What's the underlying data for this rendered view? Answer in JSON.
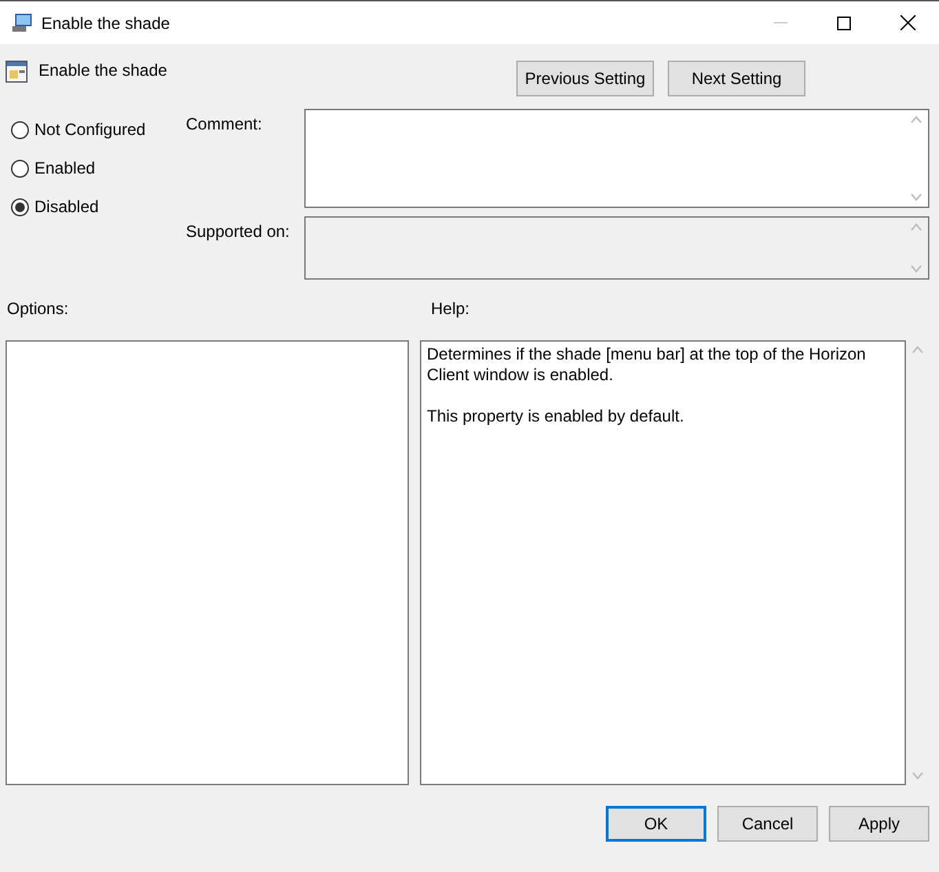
{
  "window": {
    "title": "Enable the shade"
  },
  "setting": {
    "title": "Enable the shade"
  },
  "nav_buttons": [
    "Previous Setting",
    "Next Setting"
  ],
  "state_options": [
    {
      "label": "Not Configured",
      "selected": false
    },
    {
      "label": "Enabled",
      "selected": false
    },
    {
      "label": "Disabled",
      "selected": true
    }
  ],
  "comment": {
    "label": "Comment:"
  },
  "supported_on": {
    "label": "Supported on:"
  },
  "options": {
    "label": "Options:"
  },
  "help": {
    "label": "Help:",
    "paragraphs": [
      "Determines if the shade [menu bar] at the top of the Horizon Client window is enabled.",
      "This property is enabled by default."
    ]
  },
  "dialog_buttons": [
    {
      "label": "OK",
      "default": true
    },
    {
      "label": "Cancel",
      "default": false
    },
    {
      "label": "Apply",
      "default": false
    }
  ]
}
